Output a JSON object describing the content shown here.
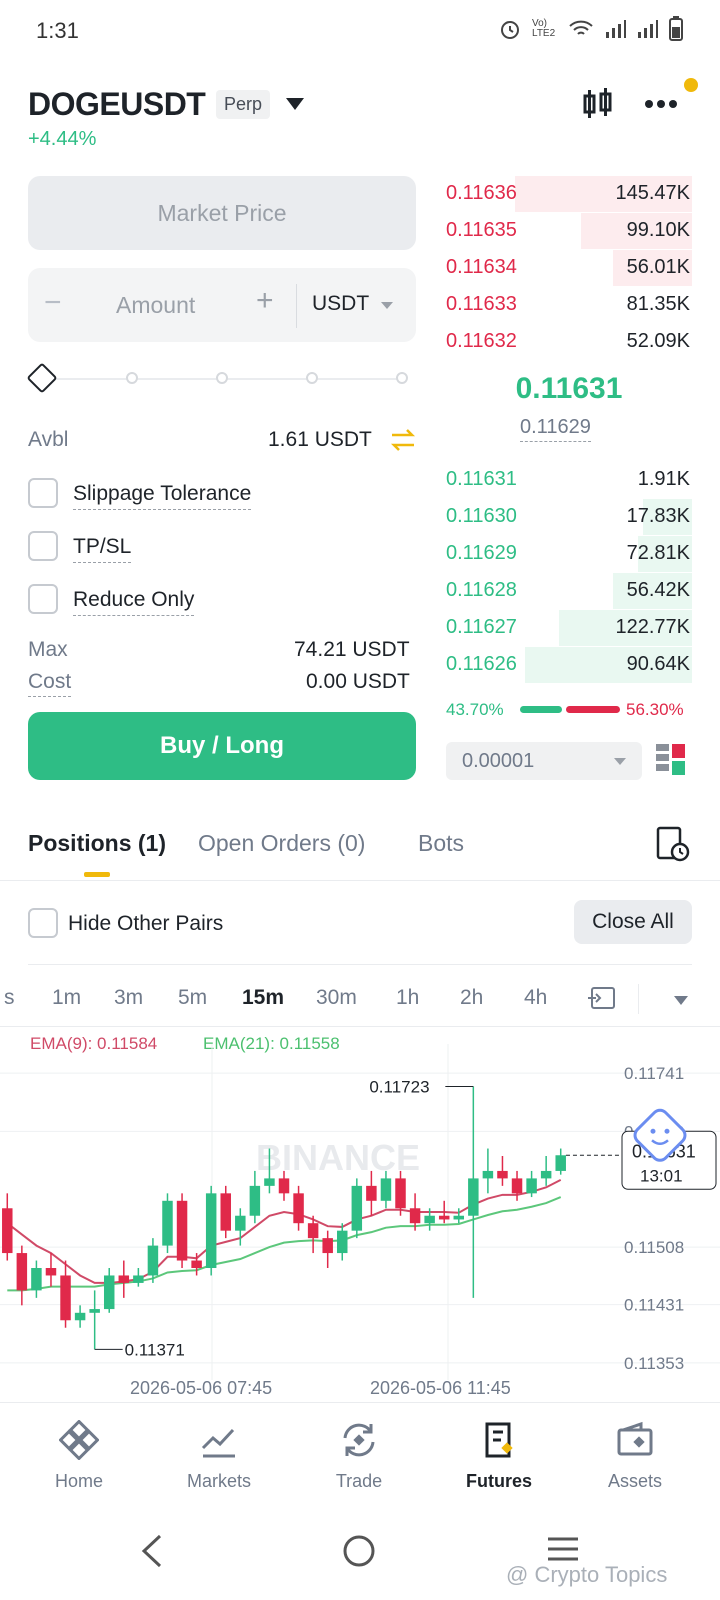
{
  "status_bar": {
    "time": "1:31",
    "network": "Vo) LTE2"
  },
  "header": {
    "symbol": "DOGEUSDT",
    "type_badge": "Perp",
    "change": "+4.44%"
  },
  "order_form": {
    "price_type": "Market Price",
    "amount_minus": "−",
    "amount_placeholder": "Amount",
    "amount_plus": "+",
    "amount_unit": "USDT",
    "slider_level": 0,
    "avbl_label": "Avbl",
    "avbl_value": "1.61 USDT",
    "options": [
      {
        "label": "Slippage Tolerance",
        "checked": false
      },
      {
        "label": "TP/SL",
        "checked": false
      },
      {
        "label": "Reduce Only",
        "checked": false
      }
    ],
    "max_label": "Max",
    "max_value": "74.21 USDT",
    "cost_label": "Cost",
    "cost_value": "0.00 USDT",
    "buy_label": "Buy / Long"
  },
  "order_book": {
    "asks": [
      {
        "price": "0.11636",
        "qty": "145.47K",
        "depth": 0.72
      },
      {
        "price": "0.11635",
        "qty": "99.10K",
        "depth": 0.45
      },
      {
        "price": "0.11634",
        "qty": "56.01K",
        "depth": 0.32
      },
      {
        "price": "0.11633",
        "qty": "81.35K",
        "depth": 0.0
      },
      {
        "price": "0.11632",
        "qty": "52.09K",
        "depth": 0.0
      }
    ],
    "last_price": "0.11631",
    "mark_price": "0.11629",
    "bids": [
      {
        "price": "0.11631",
        "qty": "1.91K",
        "depth": 0.0
      },
      {
        "price": "0.11630",
        "qty": "17.83K",
        "depth": 0.2
      },
      {
        "price": "0.11629",
        "qty": "72.81K",
        "depth": 0.22
      },
      {
        "price": "0.11628",
        "qty": "56.42K",
        "depth": 0.32
      },
      {
        "price": "0.11627",
        "qty": "122.77K",
        "depth": 0.54
      },
      {
        "price": "0.11626",
        "qty": "90.64K",
        "depth": 0.68
      }
    ],
    "buy_ratio": "43.70%",
    "sell_ratio": "56.30%",
    "precision": "0.00001"
  },
  "tabs": {
    "positions": "Positions (1)",
    "open_orders": "Open Orders (0)",
    "bots": "Bots"
  },
  "positions": {
    "hide_other_pairs": "Hide Other Pairs",
    "close_all": "Close All"
  },
  "timeframes": [
    "s",
    "1m",
    "3m",
    "5m",
    "15m",
    "30m",
    "1h",
    "2h",
    "4h"
  ],
  "active_timeframe": "15m",
  "chart_data": {
    "type": "candlestick",
    "indicators": {
      "ema9": "EMA(9): 0.11584",
      "ema21": "EMA(21): 0.11558"
    },
    "y_ticks": [
      "0.11741",
      "0.11663",
      "0.11508",
      "0.11431",
      "0.11353"
    ],
    "x_ticks": [
      "2026-05-06 07:45",
      "2026-05-06 11:45"
    ],
    "high_label": "0.11723",
    "low_label": "0.11371",
    "current_price_label": "0.11631",
    "countdown_label": "13:01",
    "watermark": "BINANCE",
    "ylim": [
      0.1133,
      0.1178
    ],
    "candles": [
      {
        "o": 0.1156,
        "h": 0.1158,
        "c": 0.115,
        "l": 0.1149
      },
      {
        "o": 0.115,
        "h": 0.1151,
        "c": 0.1145,
        "l": 0.1143
      },
      {
        "o": 0.1145,
        "h": 0.1149,
        "c": 0.1148,
        "l": 0.1144
      },
      {
        "o": 0.1148,
        "h": 0.115,
        "c": 0.1147,
        "l": 0.11455
      },
      {
        "o": 0.1147,
        "h": 0.1149,
        "c": 0.1141,
        "l": 0.114
      },
      {
        "o": 0.1141,
        "h": 0.1143,
        "c": 0.1142,
        "l": 0.114
      },
      {
        "o": 0.1142,
        "h": 0.1145,
        "c": 0.11425,
        "l": 0.11371
      },
      {
        "o": 0.11425,
        "h": 0.1148,
        "c": 0.1147,
        "l": 0.1142
      },
      {
        "o": 0.1147,
        "h": 0.1149,
        "c": 0.1146,
        "l": 0.1144
      },
      {
        "o": 0.1146,
        "h": 0.1148,
        "c": 0.1147,
        "l": 0.11455
      },
      {
        "o": 0.1147,
        "h": 0.1152,
        "c": 0.1151,
        "l": 0.1146
      },
      {
        "o": 0.1151,
        "h": 0.1158,
        "c": 0.1157,
        "l": 0.115
      },
      {
        "o": 0.1157,
        "h": 0.1158,
        "c": 0.1149,
        "l": 0.1148
      },
      {
        "o": 0.1149,
        "h": 0.115,
        "c": 0.1148,
        "l": 0.1147
      },
      {
        "o": 0.1148,
        "h": 0.1159,
        "c": 0.1158,
        "l": 0.1147
      },
      {
        "o": 0.1158,
        "h": 0.1159,
        "c": 0.1153,
        "l": 0.1152
      },
      {
        "o": 0.1153,
        "h": 0.1156,
        "c": 0.1155,
        "l": 0.1151
      },
      {
        "o": 0.1155,
        "h": 0.1161,
        "c": 0.1159,
        "l": 0.1154
      },
      {
        "o": 0.1159,
        "h": 0.1164,
        "c": 0.116,
        "l": 0.1158
      },
      {
        "o": 0.116,
        "h": 0.1161,
        "c": 0.1158,
        "l": 0.1157
      },
      {
        "o": 0.1158,
        "h": 0.1159,
        "c": 0.1154,
        "l": 0.1153
      },
      {
        "o": 0.1154,
        "h": 0.1155,
        "c": 0.1152,
        "l": 0.115
      },
      {
        "o": 0.1152,
        "h": 0.1153,
        "c": 0.115,
        "l": 0.1148
      },
      {
        "o": 0.115,
        "h": 0.1154,
        "c": 0.1153,
        "l": 0.1149
      },
      {
        "o": 0.1153,
        "h": 0.116,
        "c": 0.1159,
        "l": 0.1152
      },
      {
        "o": 0.1159,
        "h": 0.1161,
        "c": 0.1157,
        "l": 0.1155
      },
      {
        "o": 0.1157,
        "h": 0.1161,
        "c": 0.116,
        "l": 0.1156
      },
      {
        "o": 0.116,
        "h": 0.1161,
        "c": 0.1156,
        "l": 0.1155
      },
      {
        "o": 0.1156,
        "h": 0.1158,
        "c": 0.1154,
        "l": 0.1153
      },
      {
        "o": 0.1154,
        "h": 0.1156,
        "c": 0.1155,
        "l": 0.1153
      },
      {
        "o": 0.1155,
        "h": 0.1157,
        "c": 0.11545,
        "l": 0.1154
      },
      {
        "o": 0.11545,
        "h": 0.1156,
        "c": 0.1155,
        "l": 0.1154
      },
      {
        "o": 0.1155,
        "h": 0.11723,
        "c": 0.116,
        "l": 0.1144
      },
      {
        "o": 0.116,
        "h": 0.1164,
        "c": 0.1161,
        "l": 0.1158
      },
      {
        "o": 0.1161,
        "h": 0.1163,
        "c": 0.116,
        "l": 0.1159
      },
      {
        "o": 0.116,
        "h": 0.1161,
        "c": 0.1158,
        "l": 0.1157
      },
      {
        "o": 0.1158,
        "h": 0.1161,
        "c": 0.116,
        "l": 0.11575
      },
      {
        "o": 0.116,
        "h": 0.1163,
        "c": 0.1161,
        "l": 0.1159
      },
      {
        "o": 0.1161,
        "h": 0.1164,
        "c": 0.11631,
        "l": 0.11605
      }
    ],
    "ema9": [
      0.1154,
      0.11525,
      0.1151,
      0.115,
      0.11485,
      0.1147,
      0.1146,
      0.1146,
      0.11462,
      0.11465,
      0.11475,
      0.11495,
      0.11495,
      0.11493,
      0.1151,
      0.11515,
      0.1152,
      0.11535,
      0.1155,
      0.11555,
      0.11552,
      0.11545,
      0.11536,
      0.11535,
      0.11545,
      0.1155,
      0.11558,
      0.11558,
      0.11555,
      0.11555,
      0.11555,
      0.11554,
      0.11565,
      0.11573,
      0.11578,
      0.11578,
      0.11582,
      0.11588,
      0.11598
    ],
    "ema21": [
      0.1145,
      0.1145,
      0.11452,
      0.11455,
      0.11455,
      0.11455,
      0.11455,
      0.11458,
      0.1146,
      0.11462,
      0.11466,
      0.11474,
      0.11476,
      0.11477,
      0.11484,
      0.11488,
      0.11492,
      0.115,
      0.11508,
      0.11514,
      0.11516,
      0.11517,
      0.11516,
      0.11517,
      0.11524,
      0.11528,
      0.11534,
      0.11536,
      0.11536,
      0.11538,
      0.11538,
      0.11539,
      0.11545,
      0.11551,
      0.11556,
      0.11558,
      0.11562,
      0.11567,
      0.11575
    ]
  },
  "colors": {
    "up": "#2ebd85",
    "down": "#e0294a",
    "brand": "#f0b90b"
  },
  "nav": [
    {
      "label": "Home",
      "icon": "binance-logo-icon"
    },
    {
      "label": "Markets",
      "icon": "chart-line-icon"
    },
    {
      "label": "Trade",
      "icon": "trade-swap-icon"
    },
    {
      "label": "Futures",
      "icon": "futures-doc-icon",
      "active": true
    },
    {
      "label": "Assets",
      "icon": "wallet-icon"
    }
  ],
  "watermark_footer": "@ Crypto Topics"
}
